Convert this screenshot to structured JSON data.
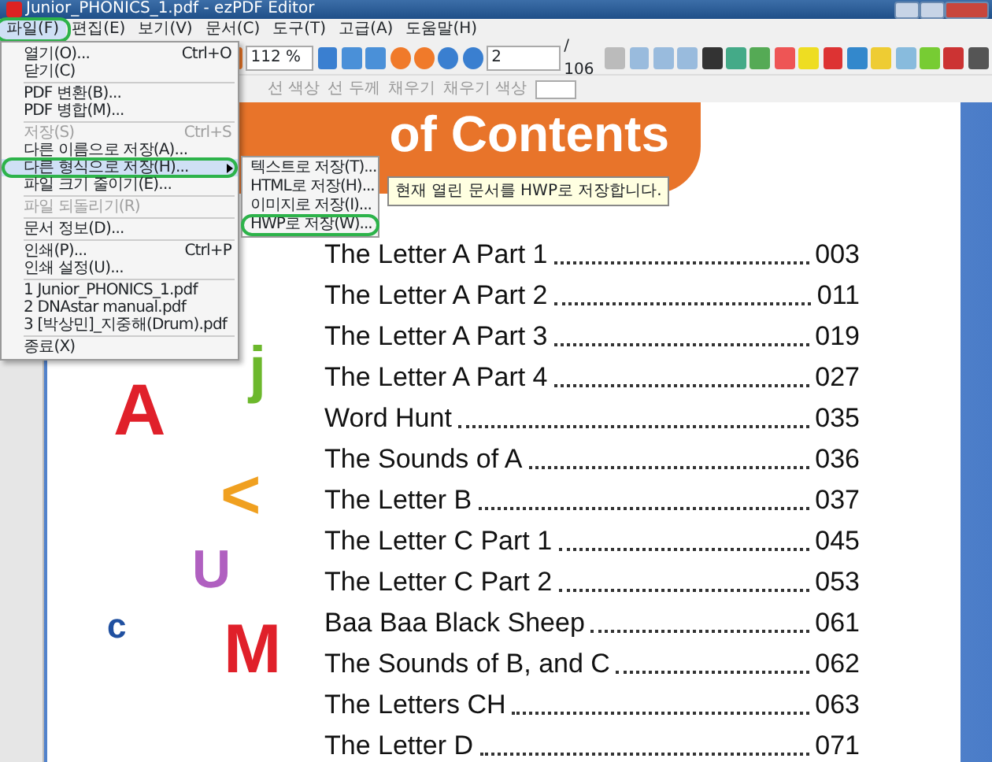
{
  "window": {
    "title": "Junior_PHONICS_1.pdf - ezPDF Editor"
  },
  "menubar": [
    {
      "label": "파일(F)",
      "selected": true
    },
    {
      "label": "편집(E)",
      "selected": false
    },
    {
      "label": "보기(V)",
      "selected": false
    },
    {
      "label": "문서(C)",
      "selected": false
    },
    {
      "label": "도구(T)",
      "selected": false
    },
    {
      "label": "고급(A)",
      "selected": false
    },
    {
      "label": "도움말(H)",
      "selected": false
    }
  ],
  "toolbar": {
    "zoom": "112 %",
    "page": "2",
    "page_total": "/ 106"
  },
  "toolbar2": [
    {
      "label": "선 색상"
    },
    {
      "label": "선 두께"
    },
    {
      "label": "채우기"
    },
    {
      "label": "채우기 색상"
    }
  ],
  "file_menu": [
    {
      "kind": "item",
      "label": "열기(O)...",
      "shortcut": "Ctrl+O",
      "disabled": false,
      "selected": false
    },
    {
      "kind": "item",
      "label": "닫기(C)",
      "disabled": false,
      "selected": false
    },
    {
      "kind": "separator"
    },
    {
      "kind": "item",
      "label": "PDF 변환(B)...",
      "disabled": false,
      "selected": false
    },
    {
      "kind": "item",
      "label": "PDF 병합(M)...",
      "disabled": false,
      "selected": false
    },
    {
      "kind": "separator"
    },
    {
      "kind": "item",
      "label": "저장(S)",
      "shortcut": "Ctrl+S",
      "disabled": true,
      "selected": false
    },
    {
      "kind": "item",
      "label": "다른 이름으로 저장(A)...",
      "disabled": false,
      "selected": false
    },
    {
      "kind": "submenu",
      "label": "다른 형식으로 저장(H)...",
      "disabled": false,
      "selected": true
    },
    {
      "kind": "item",
      "label": "파일 크기 줄이기(E)...",
      "disabled": false,
      "selected": false
    },
    {
      "kind": "separator"
    },
    {
      "kind": "item",
      "label": "파일 되돌리기(R)",
      "disabled": true,
      "selected": false
    },
    {
      "kind": "separator"
    },
    {
      "kind": "item",
      "label": "문서 정보(D)...",
      "disabled": false,
      "selected": false
    },
    {
      "kind": "separator"
    },
    {
      "kind": "item",
      "label": "인쇄(P)...",
      "shortcut": "Ctrl+P",
      "disabled": false,
      "selected": false
    },
    {
      "kind": "item",
      "label": "인쇄 설정(U)...",
      "disabled": false,
      "selected": false
    },
    {
      "kind": "separator"
    },
    {
      "kind": "item",
      "label": "1 Junior_PHONICS_1.pdf",
      "disabled": false,
      "selected": false
    },
    {
      "kind": "item",
      "label": "2 DNAstar manual.pdf",
      "disabled": false,
      "selected": false
    },
    {
      "kind": "item",
      "label": "3 [박상민]_지중해(Drum).pdf",
      "disabled": false,
      "selected": false
    },
    {
      "kind": "separator"
    },
    {
      "kind": "item",
      "label": "종료(X)",
      "disabled": false,
      "selected": false
    }
  ],
  "submenu": [
    {
      "label": "텍스트로 저장(T)..."
    },
    {
      "label": "HTML로 저장(H)..."
    },
    {
      "label": "이미지로 저장(I)..."
    },
    {
      "label": "HWP로 저장(W)..."
    }
  ],
  "tooltip": {
    "text": "현재 열린 문서를 HWP로 저장합니다."
  },
  "document": {
    "banner": "of Contents",
    "letters": [
      {
        "text": "A",
        "color": "#e0202a"
      },
      {
        "text": "j",
        "color": "#6cb82c"
      },
      {
        "text": "<",
        "color": "#f0a020"
      },
      {
        "text": "U",
        "color": "#b060c0"
      },
      {
        "text": "c",
        "color": "#2050a0"
      },
      {
        "text": "M",
        "color": "#e0202a"
      }
    ],
    "toc": [
      {
        "title": "The Letter A Part 1",
        "page": "003"
      },
      {
        "title": "The Letter A Part 2",
        "page": "011"
      },
      {
        "title": "The Letter A Part 3",
        "page": "019"
      },
      {
        "title": "The Letter A Part 4",
        "page": "027"
      },
      {
        "title": "Word Hunt",
        "page": "035"
      },
      {
        "title": "The Sounds of A",
        "page": "036"
      },
      {
        "title": "The Letter B",
        "page": "037"
      },
      {
        "title": "The Letter C Part 1",
        "page": "045"
      },
      {
        "title": "The Letter C Part 2",
        "page": "053"
      },
      {
        "title": "Baa Baa Black Sheep",
        "page": "061"
      },
      {
        "title": "The Sounds of B, and C",
        "page": "062"
      },
      {
        "title": "The Letters CH",
        "page": "063"
      },
      {
        "title": "The Letter D",
        "page": "071"
      }
    ]
  }
}
